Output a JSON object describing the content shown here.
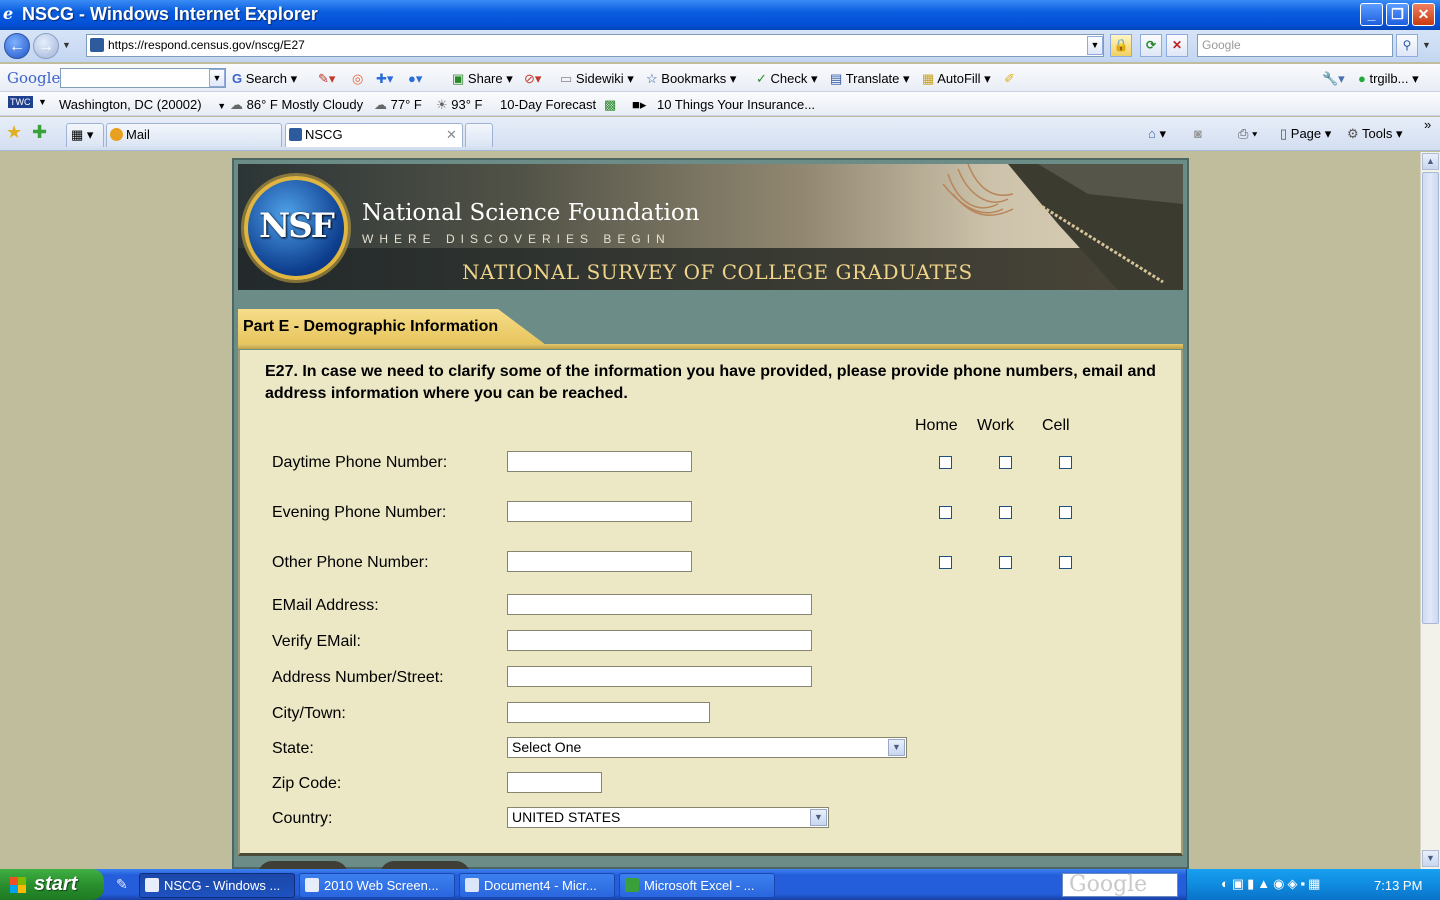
{
  "window": {
    "title": "NSCG - Windows Internet Explorer"
  },
  "address": {
    "url": "https://respond.census.gov/nscg/E27",
    "search_placeholder": "Google"
  },
  "google_toolbar": {
    "logo": "Google",
    "search_label": "Search",
    "share": "Share",
    "sidewiki": "Sidewiki",
    "bookmarks": "Bookmarks",
    "check": "Check",
    "translate": "Translate",
    "autofill": "AutoFill",
    "user": "trgilb..."
  },
  "weather_bar": {
    "badge": "TWC",
    "location": "Washington, DC (20002)",
    "current": "86° F Mostly Cloudy",
    "temp2": "77° F",
    "temp3": "93° F",
    "forecast": "10-Day Forecast",
    "news": "10 Things Your Insurance..."
  },
  "tabs": [
    {
      "label": "Mail"
    },
    {
      "label": "NSCG"
    }
  ],
  "command_bar": {
    "page": "Page",
    "tools": "Tools"
  },
  "banner": {
    "org_name": "National Science Foundation",
    "tagline": "WHERE DISCOVERIES BEGIN",
    "survey_title": "NATIONAL SURVEY OF COLLEGE GRADUATES",
    "logo_text": "NSF"
  },
  "section": {
    "title": "Part E - Demographic Information"
  },
  "question": {
    "text": "E27. In case we need to clarify some of the information you have provided, please provide phone numbers, email and address information where you can be reached."
  },
  "columns": {
    "home": "Home",
    "work": "Work",
    "cell": "Cell"
  },
  "fields": {
    "daytime_phone": {
      "label": "Daytime Phone Number:",
      "value": ""
    },
    "evening_phone": {
      "label": "Evening Phone Number:",
      "value": ""
    },
    "other_phone": {
      "label": "Other Phone Number:",
      "value": ""
    },
    "email": {
      "label": "EMail Address:",
      "value": ""
    },
    "verify_email": {
      "label": "Verify EMail:",
      "value": ""
    },
    "street": {
      "label": "Address Number/Street:",
      "value": ""
    },
    "city": {
      "label": "City/Town:",
      "value": ""
    },
    "state": {
      "label": "State:",
      "value": "Select One"
    },
    "zip": {
      "label": "Zip Code:",
      "value": ""
    },
    "country": {
      "label": "Country:",
      "value": "UNITED STATES"
    }
  },
  "taskbar": {
    "start": "start",
    "tasks": [
      {
        "label": "NSCG - Windows ..."
      },
      {
        "label": "2010 Web Screen..."
      },
      {
        "label": "Document4 - Micr..."
      },
      {
        "label": "Microsoft Excel - ..."
      }
    ],
    "desktop_search": "Google",
    "clock": "7:13 PM"
  },
  "colors": {
    "accent_gold": "#e7c45c",
    "form_bg": "#ece8c6",
    "frame_teal": "#6c8c88",
    "xp_blue": "#245edb",
    "xp_green": "#2a8f2e"
  }
}
